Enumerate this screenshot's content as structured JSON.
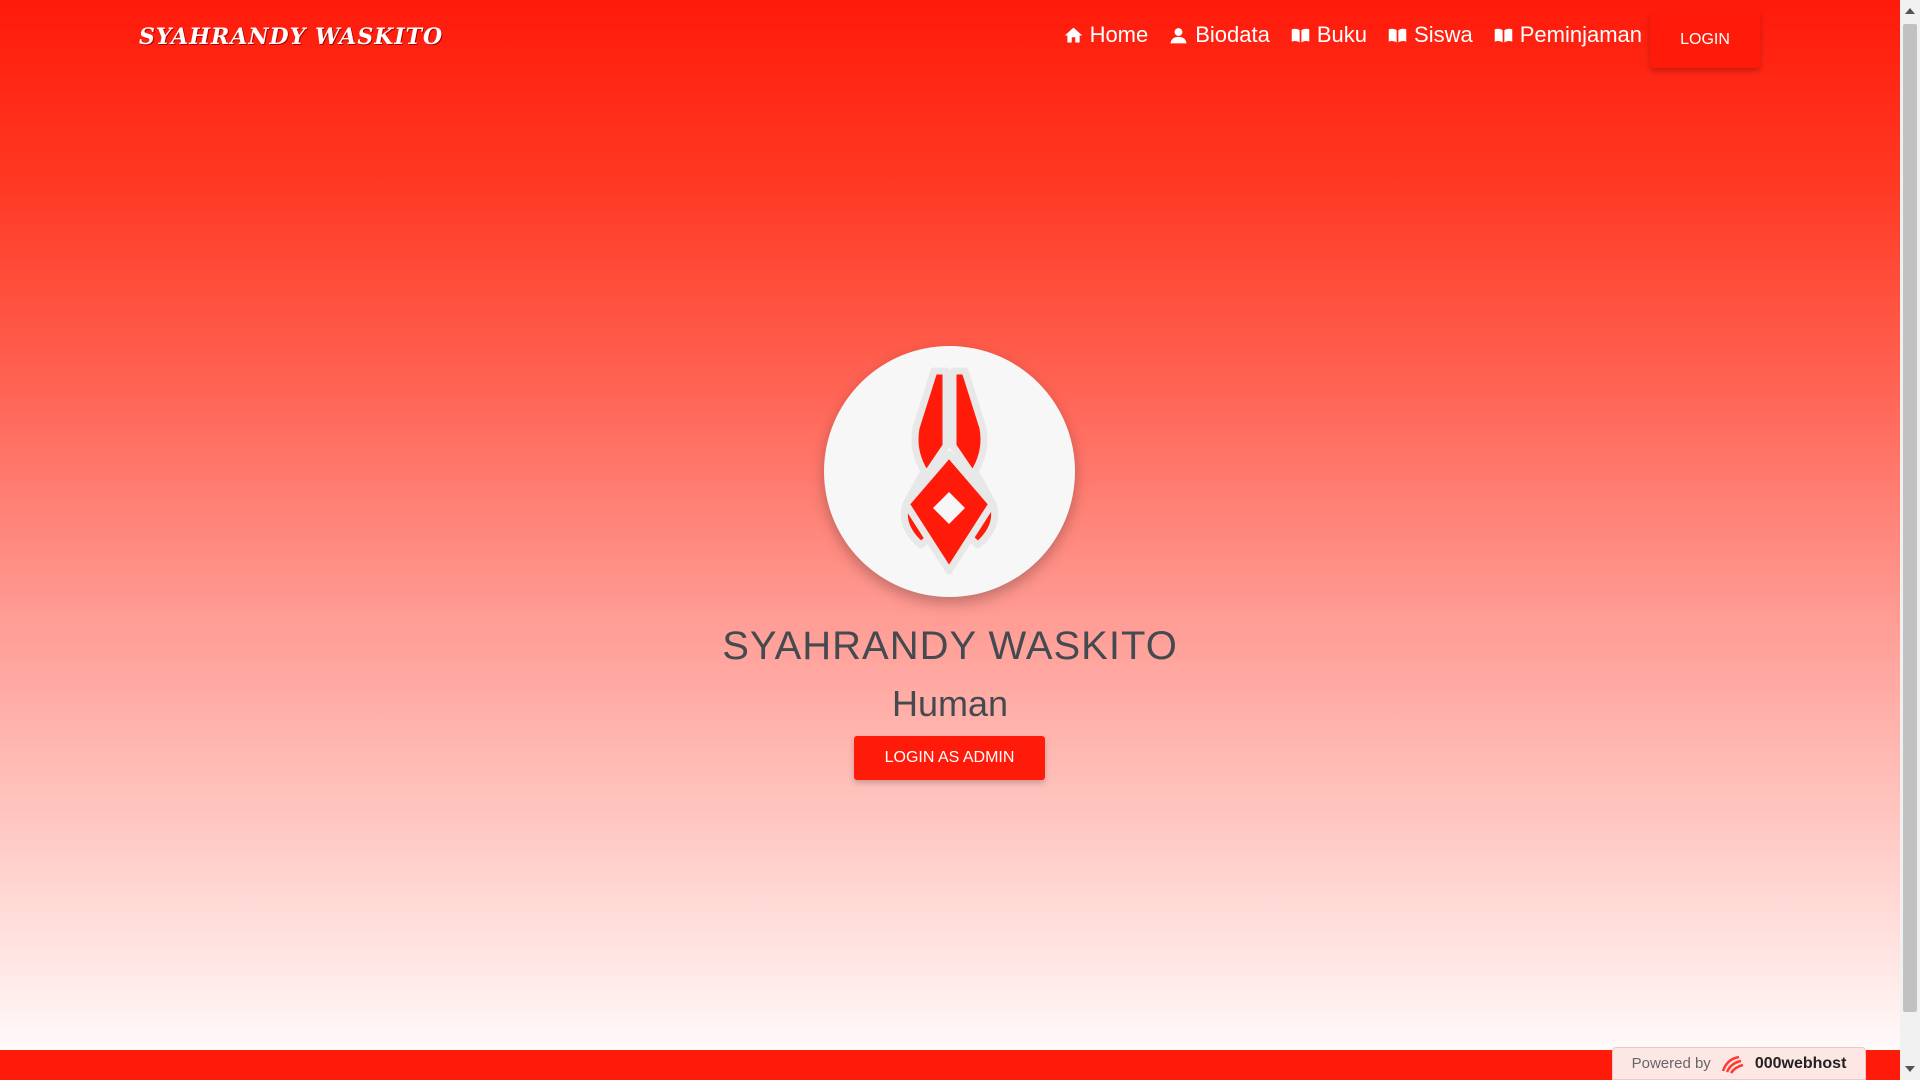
{
  "navbar": {
    "brand": "SYAHRANDY WASKITO",
    "items": [
      {
        "label": "Home",
        "icon": "home-icon"
      },
      {
        "label": "Biodata",
        "icon": "user-icon"
      },
      {
        "label": "Buku",
        "icon": "book-icon"
      },
      {
        "label": "Siswa",
        "icon": "book-icon"
      },
      {
        "label": "Peminjaman",
        "icon": "book-icon"
      }
    ],
    "login_label": "LOGIN"
  },
  "hero": {
    "name": "SYAHRANDY WASKITO",
    "role": "Human",
    "admin_button_label": "LOGIN AS ADMIN",
    "avatar_icon": "horned-emblem-icon"
  },
  "footer": {
    "powered_by": "Powered by",
    "host": "000webhost"
  },
  "colors": {
    "accent": "#ff1a0a",
    "text_dark": "#444a50"
  }
}
